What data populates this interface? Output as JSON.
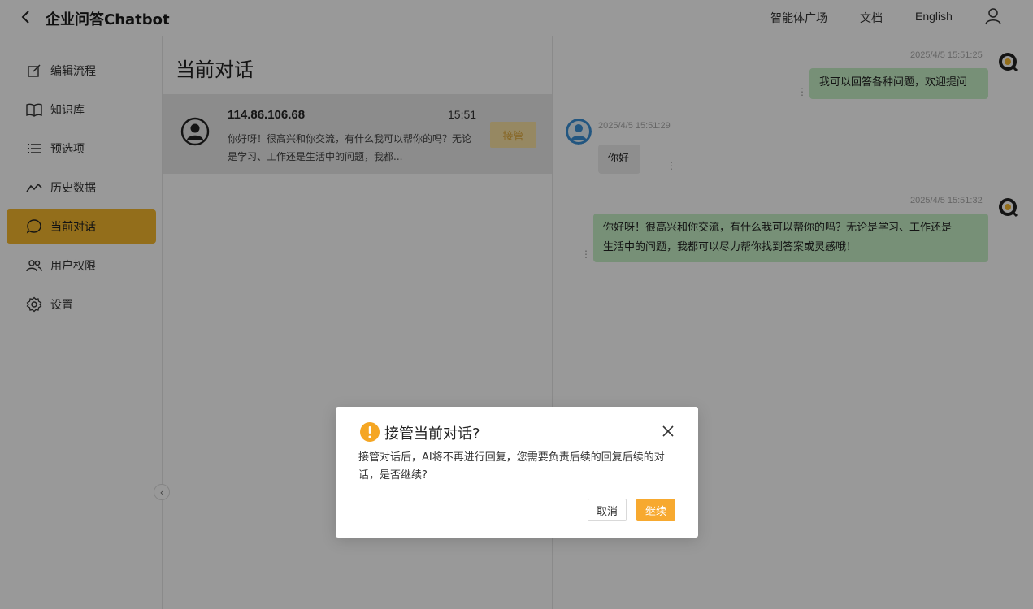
{
  "header": {
    "title": "企业问答Chatbot",
    "nav": {
      "plaza": "智能体广场",
      "docs": "文档",
      "language": "English"
    }
  },
  "sidebar": {
    "items": [
      {
        "label": "编辑流程",
        "icon": "edit-icon"
      },
      {
        "label": "知识库",
        "icon": "book-icon"
      },
      {
        "label": "预选项",
        "icon": "list-icon"
      },
      {
        "label": "历史数据",
        "icon": "trend-icon"
      },
      {
        "label": "当前对话",
        "icon": "chat-icon",
        "active": true
      },
      {
        "label": "用户权限",
        "icon": "users-icon"
      },
      {
        "label": "设置",
        "icon": "gear-icon"
      }
    ],
    "collapse_icon": "‹"
  },
  "conversations": {
    "heading": "当前对话",
    "items": [
      {
        "ip": "114.86.106.68",
        "time": "15:51",
        "preview": "你好呀！很高兴和你交流，有什么我可以帮你的吗？无论是学习、工作还是生活中的问题，我都...",
        "takeover_label": "接管"
      }
    ]
  },
  "chat": {
    "messages": [
      {
        "role": "bot",
        "timestamp": "2025/4/5 15:51:25",
        "text": "我可以回答各种问题，欢迎提问"
      },
      {
        "role": "user",
        "timestamp": "2025/4/5 15:51:29",
        "text": "你好"
      },
      {
        "role": "bot",
        "timestamp": "2025/4/5 15:51:32",
        "text_line1": "你好呀！很高兴和你交流，有什么我可以帮你的吗？无论是学习、工作还是",
        "text_line2": "生活中的问题，我都可以尽力帮你找到答案或灵感哦！"
      }
    ]
  },
  "modal": {
    "title": "接管当前对话?",
    "body": "接管对话后，AI将不再进行回复，您需要负责后续的回复后续的对话，是否继续?",
    "cancel_label": "取消",
    "continue_label": "继续"
  },
  "colors": {
    "accent": "#f5b82e",
    "bot_bubble": "#c6f0c6",
    "warning": "#f5a623",
    "overlay": "rgba(0,0,0,0.4)"
  }
}
